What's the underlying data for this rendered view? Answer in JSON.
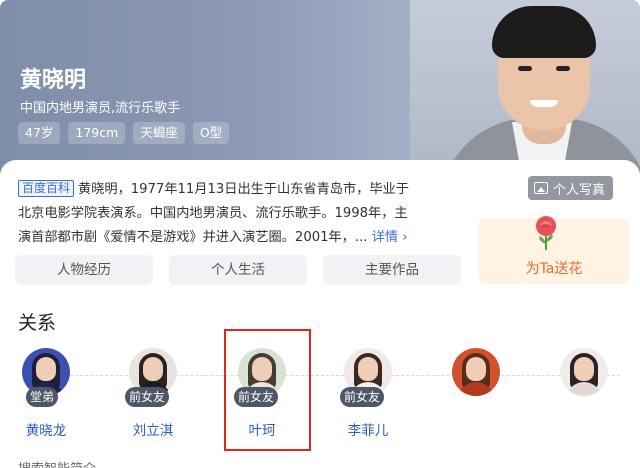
{
  "profile": {
    "name": "黄晓明",
    "subtitle": "中国内地男演员,流行乐歌手",
    "tags": [
      "47岁",
      "179cm",
      "天蝎座",
      "O型"
    ],
    "photo_button": "个人写真"
  },
  "intro": {
    "badge": "百度百科",
    "text": "黄晓明，1977年11月13日出生于山东省青岛市，毕业于北京电影学院表演系。中国内地男演员、流行乐歌手。1998年，主演首部都市剧《爱情不是游戏》并进入演艺圈。2001年，...",
    "more": "详情 ›"
  },
  "flower": {
    "label": "为Ta送花"
  },
  "tabs": [
    "人物经历",
    "个人生活",
    "主要作品"
  ],
  "relations": {
    "title": "关系",
    "people": [
      {
        "role": "堂弟",
        "name": "黄晓龙"
      },
      {
        "role": "前女友",
        "name": "刘立淇"
      },
      {
        "role": "前女友",
        "name": "叶珂"
      },
      {
        "role": "前女友",
        "name": "李菲儿"
      },
      {
        "role": "",
        "name": ""
      },
      {
        "role": "",
        "name": ""
      }
    ]
  },
  "bottom_hint": "搜索智能简介",
  "colors": {
    "accent_link": "#3b6fd8",
    "highlight_box": "#e0261e",
    "flower_text": "#e06c2c",
    "role_badge": "#4e5669"
  }
}
